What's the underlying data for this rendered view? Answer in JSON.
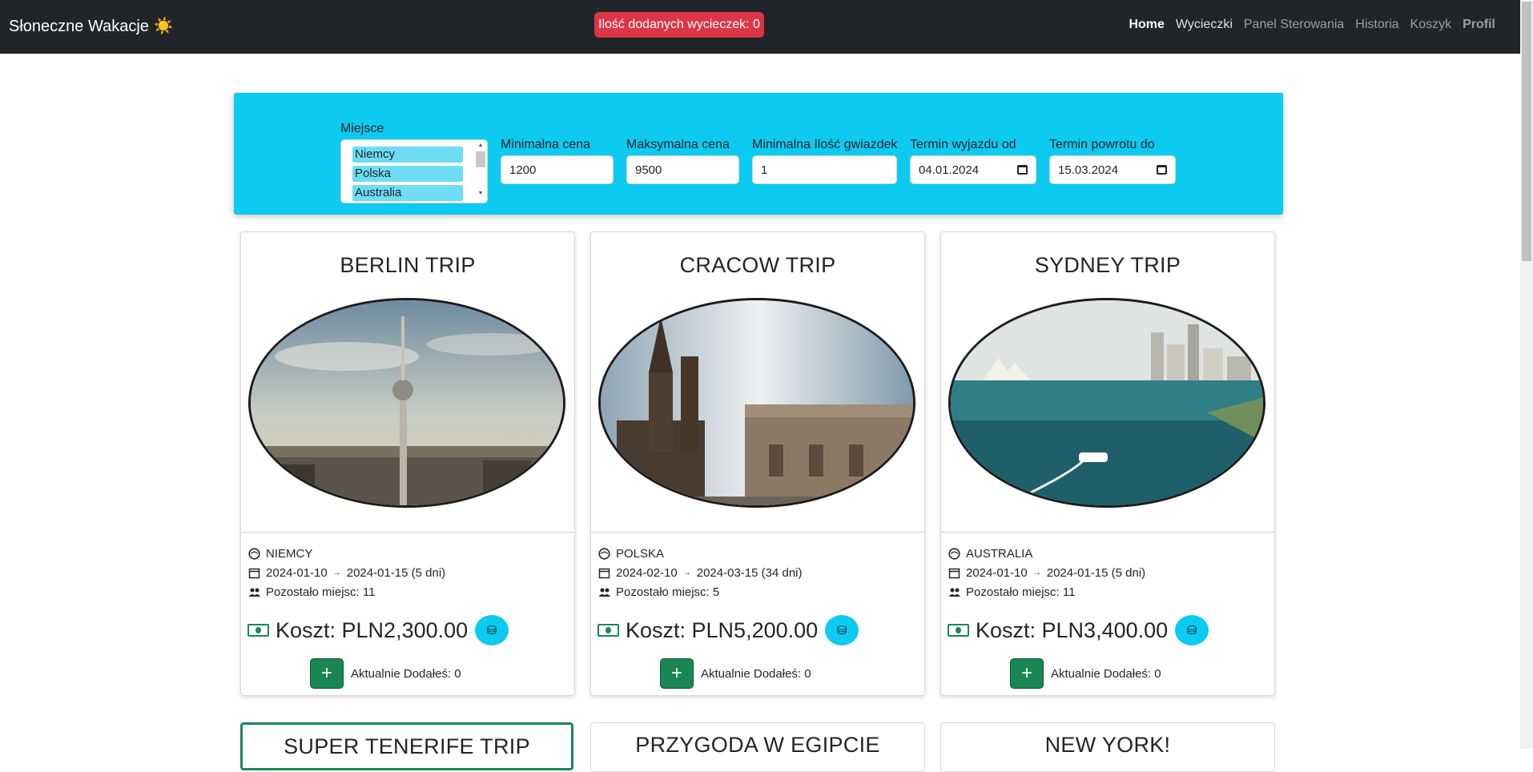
{
  "navbar": {
    "brand": "Słoneczne Wakacje ☀️",
    "counter": "Ilość dodanych wycieczek: 0",
    "links": [
      "Home",
      "Wycieczki",
      "Panel Sterowania",
      "Historia",
      "Koszyk",
      "Profil"
    ]
  },
  "filters": {
    "place_label": "Miejsce",
    "place_options": [
      "Niemcy",
      "Polska",
      "Australia"
    ],
    "min_price_label": "Minimalna cena",
    "min_price_value": "1200",
    "max_price_label": "Maksymalna cena",
    "max_price_value": "9500",
    "min_stars_label": "Minimalna Ilość gwiazdek",
    "min_stars_value": "1",
    "date_from_label": "Termin wyjazdu od",
    "date_from_value": "04.01.2024",
    "date_to_label": "Termin powrotu do",
    "date_to_value": "15.03.2024"
  },
  "trips": [
    {
      "title": "BERLIN TRIP",
      "country": "NIEMCY",
      "date_start": "2024-01-10",
      "date_end": "2024-01-15 (5 dni)",
      "places_left": "Pozostało miejsc: 11",
      "price": "Koszt: PLN2,300.00",
      "added": "Aktualnie Dodałeś: 0"
    },
    {
      "title": "CRACOW TRIP",
      "country": "POLSKA",
      "date_start": "2024-02-10",
      "date_end": "2024-03-15 (34 dni)",
      "places_left": "Pozostało miejsc: 5",
      "price": "Koszt: PLN5,200.00",
      "added": "Aktualnie Dodałeś: 0"
    },
    {
      "title": "SYDNEY TRIP",
      "country": "AUSTRALIA",
      "date_start": "2024-01-10",
      "date_end": "2024-01-15 (5 dni)",
      "places_left": "Pozostało miejsc: 11",
      "price": "Koszt: PLN3,400.00",
      "added": "Aktualnie Dodałeś: 0"
    }
  ],
  "trips_row2": [
    "SUPER TENERIFE TRIP",
    "PRZYGODA W EGIPCIE",
    "NEW YORK!"
  ],
  "icons": {
    "globe": "globe-icon",
    "calendar": "calendar-icon",
    "people": "people-icon",
    "money": "cash-icon",
    "coin": "coins-icon",
    "add": "plus-icon"
  },
  "colors": {
    "navbar": "#212529",
    "badge": "#dc3545",
    "filter_panel": "#0dcaf0",
    "accent_green": "#198754",
    "accent_cyan": "#0dcaf0"
  }
}
